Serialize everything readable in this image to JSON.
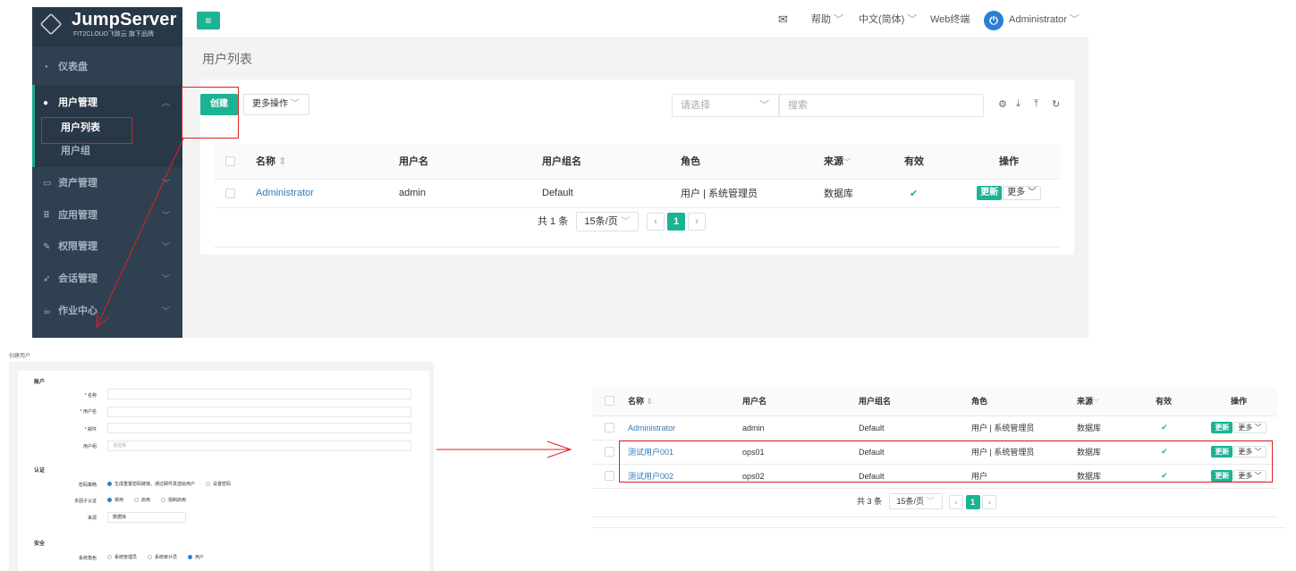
{
  "brand": {
    "name": "JumpServer",
    "tagline": "FIT2CLOUD飞致云 旗下品牌"
  },
  "sidebar": {
    "items": [
      {
        "label": "仪表盘",
        "icon": "dashboard-icon"
      },
      {
        "label": "用户管理",
        "icon": "users-icon"
      },
      {
        "label": "资产管理",
        "icon": "inbox-icon"
      },
      {
        "label": "应用管理",
        "icon": "grid-icon"
      },
      {
        "label": "权限管理",
        "icon": "edit-icon"
      },
      {
        "label": "会话管理",
        "icon": "rocket-icon"
      },
      {
        "label": "作业中心",
        "icon": "coffee-icon"
      }
    ],
    "sub_items": [
      "用户列表",
      "用户组"
    ]
  },
  "topbar": {
    "help": "帮助",
    "language": "中文(简体)",
    "web_terminal": "Web终端",
    "user": "Administrator"
  },
  "page": {
    "title": "用户列表"
  },
  "toolbar": {
    "create": "创建",
    "more_actions": "更多操作",
    "select_placeholder": "请选择",
    "search_placeholder": "搜索"
  },
  "table": {
    "headers": [
      "名称",
      "用户名",
      "用户组名",
      "角色",
      "来源",
      "有效",
      "操作"
    ],
    "row_update": "更新",
    "row_more": "更多",
    "rows": [
      {
        "name": "Administrator",
        "username": "admin",
        "group": "Default",
        "role": "用户 | 系统管理员",
        "source": "数据库"
      }
    ]
  },
  "pagination": {
    "total": "共 1 条",
    "page_size": "15条/页",
    "current": "1"
  },
  "form": {
    "caption": "创建用户",
    "sections": {
      "account": "账户",
      "auth": "认证",
      "security": "安全"
    },
    "labels": {
      "name": "* 名称",
      "username": "* 用户名",
      "email": "* 邮件",
      "group": "用户组",
      "password_strategy": "密码策略",
      "mfa": "多因子认证",
      "source": "来源",
      "system_role": "系统角色"
    },
    "group_placeholder": "请选择",
    "password_options": [
      "生成重置密码链接，通过邮件发送给用户",
      "设置密码"
    ],
    "mfa_options": [
      "禁用",
      "启用",
      "强制启用"
    ],
    "source_value": "数据库",
    "role_options": [
      "系统管理员",
      "系统审计员",
      "用户"
    ]
  },
  "result": {
    "rows": [
      {
        "name": "Administrator",
        "username": "admin",
        "group": "Default",
        "role": "用户 | 系统管理员",
        "source": "数据库"
      },
      {
        "name": "测试用户001",
        "username": "ops01",
        "group": "Default",
        "role": "用户 | 系统管理员",
        "source": "数据库"
      },
      {
        "name": "测试用户002",
        "username": "ops02",
        "group": "Default",
        "role": "用户",
        "source": "数据库"
      }
    ],
    "pagination": {
      "total": "共 3 条",
      "page_size": "15条/页",
      "current": "1"
    }
  },
  "colors": {
    "accent": "#1ab394",
    "sidebar": "#2f4050",
    "link": "#337ab7",
    "annotation": "#e02020"
  }
}
